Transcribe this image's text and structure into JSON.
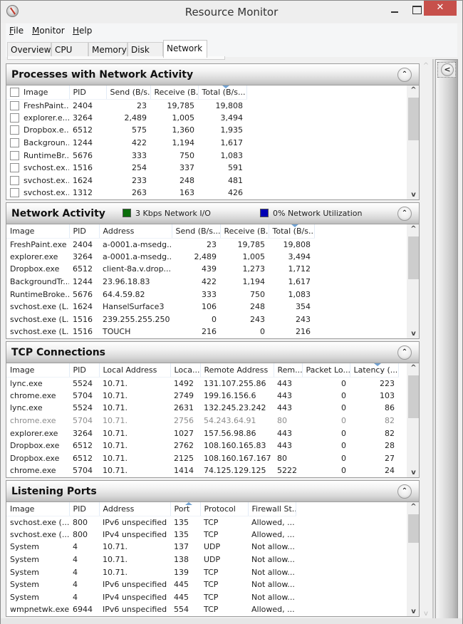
{
  "window": {
    "title": "Resource Monitor",
    "close_glyph": "✕"
  },
  "menu": [
    {
      "label": "File",
      "accel": "F",
      "rest": "ile"
    },
    {
      "label": "Monitor",
      "accel": "M",
      "rest": "onitor"
    },
    {
      "label": "Help",
      "accel": "H",
      "rest": "elp"
    }
  ],
  "tabs": [
    "Overview",
    "CPU",
    "Memory",
    "Disk",
    "Network"
  ],
  "active_tab": "Network",
  "panels": {
    "processes": {
      "title": "Processes with Network Activity",
      "columns": [
        "Image",
        "PID",
        "Send (B/s...",
        "Receive (B...",
        "Total (B/s..."
      ],
      "sorted_column": "Total (B/s...",
      "rows": [
        {
          "image": "FreshPaint....",
          "pid": "2404",
          "send": "23",
          "receive": "19,785",
          "total": "19,808",
          "checked": false
        },
        {
          "image": "explorer.e...",
          "pid": "3264",
          "send": "2,489",
          "receive": "1,005",
          "total": "3,494",
          "checked": false
        },
        {
          "image": "Dropbox.e...",
          "pid": "6512",
          "send": "575",
          "receive": "1,360",
          "total": "1,935",
          "checked": false
        },
        {
          "image": "Backgroun...",
          "pid": "1244",
          "send": "422",
          "receive": "1,194",
          "total": "1,617",
          "checked": false
        },
        {
          "image": "RuntimeBr...",
          "pid": "5676",
          "send": "333",
          "receive": "750",
          "total": "1,083",
          "checked": false
        },
        {
          "image": "svchost.ex...",
          "pid": "1516",
          "send": "254",
          "receive": "337",
          "total": "591",
          "checked": false
        },
        {
          "image": "svchost.ex...",
          "pid": "1624",
          "send": "233",
          "receive": "248",
          "total": "481",
          "checked": false
        },
        {
          "image": "svchost.ex...",
          "pid": "1312",
          "send": "263",
          "receive": "163",
          "total": "426",
          "checked": false
        }
      ]
    },
    "network_activity": {
      "title": "Network Activity",
      "legend": [
        {
          "label": "3 Kbps Network I/O",
          "color": "#0a6e0a"
        },
        {
          "label": "0% Network Utilization",
          "color": "#0000b4"
        }
      ],
      "columns": [
        "Image",
        "PID",
        "Address",
        "Send (B/s...",
        "Receive (B...",
        "Total (B/s..."
      ],
      "sorted_column": "Total (B/s...",
      "rows": [
        {
          "image": "FreshPaint.exe",
          "pid": "2404",
          "address": "a-0001.a-msedg...",
          "send": "23",
          "receive": "19,785",
          "total": "19,808"
        },
        {
          "image": "explorer.exe",
          "pid": "3264",
          "address": "a-0001.a-msedg...",
          "send": "2,489",
          "receive": "1,005",
          "total": "3,494"
        },
        {
          "image": "Dropbox.exe",
          "pid": "6512",
          "address": "client-8a.v.drop...",
          "send": "439",
          "receive": "1,273",
          "total": "1,712"
        },
        {
          "image": "BackgroundTr...",
          "pid": "1244",
          "address": "23.96.18.83",
          "send": "422",
          "receive": "1,194",
          "total": "1,617"
        },
        {
          "image": "RuntimeBroke...",
          "pid": "5676",
          "address": "64.4.59.82",
          "send": "333",
          "receive": "750",
          "total": "1,083"
        },
        {
          "image": "svchost.exe (L...",
          "pid": "1624",
          "address": "HanselSurface3",
          "send": "106",
          "receive": "248",
          "total": "354"
        },
        {
          "image": "svchost.exe (L...",
          "pid": "1516",
          "address": "239.255.255.250",
          "send": "0",
          "receive": "243",
          "total": "243"
        },
        {
          "image": "svchost.exe (L...",
          "pid": "1516",
          "address": "TOUCH",
          "send": "216",
          "receive": "0",
          "total": "216"
        }
      ]
    },
    "tcp": {
      "title": "TCP Connections",
      "columns": [
        "Image",
        "PID",
        "Local Address",
        "Loca...",
        "Remote Address",
        "Rem...",
        "Packet Lo...",
        "Latency (..."
      ],
      "sorted_column": "Latency (...",
      "rows": [
        {
          "image": "lync.exe",
          "pid": "5524",
          "local_address": "10.71.",
          "local_port": "1492",
          "remote_address": "131.107.255.86",
          "remote_port": "443",
          "packet_loss": "0",
          "latency": "223",
          "dim": false
        },
        {
          "image": "chrome.exe",
          "pid": "5704",
          "local_address": "10.71.",
          "local_port": "2749",
          "remote_address": "199.16.156.6",
          "remote_port": "443",
          "packet_loss": "0",
          "latency": "103",
          "dim": false
        },
        {
          "image": "lync.exe",
          "pid": "5524",
          "local_address": "10.71.",
          "local_port": "2631",
          "remote_address": "132.245.23.242",
          "remote_port": "443",
          "packet_loss": "0",
          "latency": "86",
          "dim": false
        },
        {
          "image": "chrome.exe",
          "pid": "5704",
          "local_address": "10.71.",
          "local_port": "2756",
          "remote_address": "54.243.64.91",
          "remote_port": "80",
          "packet_loss": "0",
          "latency": "82",
          "dim": true
        },
        {
          "image": "explorer.exe",
          "pid": "3264",
          "local_address": "10.71.",
          "local_port": "1027",
          "remote_address": "157.56.98.86",
          "remote_port": "443",
          "packet_loss": "0",
          "latency": "82",
          "dim": false
        },
        {
          "image": "Dropbox.exe",
          "pid": "6512",
          "local_address": "10.71.",
          "local_port": "2762",
          "remote_address": "108.160.165.83",
          "remote_port": "443",
          "packet_loss": "0",
          "latency": "28",
          "dim": false
        },
        {
          "image": "Dropbox.exe",
          "pid": "6512",
          "local_address": "10.71.",
          "local_port": "2125",
          "remote_address": "108.160.167.167",
          "remote_port": "80",
          "packet_loss": "0",
          "latency": "27",
          "dim": false
        },
        {
          "image": "chrome.exe",
          "pid": "5704",
          "local_address": "10.71.",
          "local_port": "1414",
          "remote_address": "74.125.129.125",
          "remote_port": "5222",
          "packet_loss": "0",
          "latency": "24",
          "dim": false
        }
      ]
    },
    "listening": {
      "title": "Listening Ports",
      "columns": [
        "Image",
        "PID",
        "Address",
        "Port",
        "Protocol",
        "Firewall St..."
      ],
      "sorted_column": "Port",
      "rows": [
        {
          "image": "svchost.exe (...",
          "pid": "800",
          "address": "IPv6 unspecified",
          "port": "135",
          "protocol": "TCP",
          "firewall": "Allowed, ..."
        },
        {
          "image": "svchost.exe (...",
          "pid": "800",
          "address": "IPv4 unspecified",
          "port": "135",
          "protocol": "TCP",
          "firewall": "Allowed, ..."
        },
        {
          "image": "System",
          "pid": "4",
          "address": "10.71.",
          "port": "137",
          "protocol": "UDP",
          "firewall": "Not allow..."
        },
        {
          "image": "System",
          "pid": "4",
          "address": "10.71.",
          "port": "138",
          "protocol": "UDP",
          "firewall": "Not allow..."
        },
        {
          "image": "System",
          "pid": "4",
          "address": "10.71.",
          "port": "139",
          "protocol": "TCP",
          "firewall": "Not allow..."
        },
        {
          "image": "System",
          "pid": "4",
          "address": "IPv6 unspecified",
          "port": "445",
          "protocol": "TCP",
          "firewall": "Not allow..."
        },
        {
          "image": "System",
          "pid": "4",
          "address": "IPv4 unspecified",
          "port": "445",
          "protocol": "TCP",
          "firewall": "Not allow..."
        },
        {
          "image": "wmpnetwk.exe",
          "pid": "6944",
          "address": "IPv6 unspecified",
          "port": "554",
          "protocol": "TCP",
          "firewall": "Allowed, ..."
        }
      ]
    }
  },
  "icons": {
    "collapse": "⌃",
    "expand_side": "<",
    "scroll_up": "^",
    "scroll_down": "v"
  }
}
